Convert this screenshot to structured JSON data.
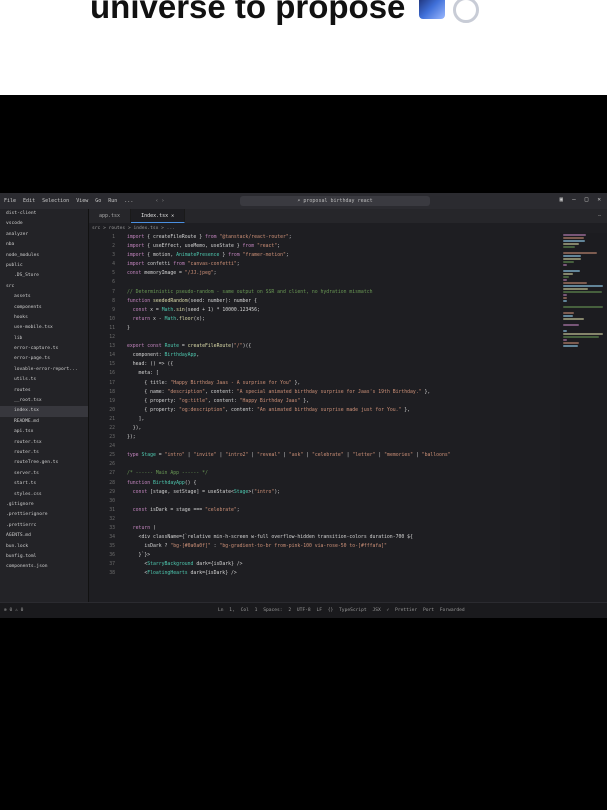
{
  "caption": {
    "text": "universe to propose",
    "emoji_1": "galaxy",
    "emoji_2": "ring"
  },
  "editor": {
    "menu": [
      "File",
      "Edit",
      "Selection",
      "View",
      "Go",
      "Run",
      "..."
    ],
    "search": "proposal birthday react",
    "tabs": [
      "app.tsx",
      "Index.tsx"
    ],
    "active_tab": 1,
    "breadcrumb": "src > routes > index.tsx > ...",
    "sidebar_items": [
      "dist-client",
      "vscode",
      "analyzer",
      "nba",
      "node_modules",
      "public",
      "  .DS_Store",
      "src",
      "  assets",
      "  components",
      "  hooks",
      "  use-mobile.tsx",
      "  lib",
      "  error-capture.ts",
      "  error-page.ts",
      "  lovable-error-report...",
      "  utils.ts",
      "  routes",
      "  __root.tsx",
      "  index.tsx",
      "  README.md",
      "  api.tsx",
      "  router.tsx",
      "  router.ts",
      "  routeTree.gen.ts",
      "  server.ts",
      "  start.ts",
      "  styles.css",
      ".gitignore",
      ".prettierignore",
      ".prettierrc",
      "AGENTS.md",
      "bun.lock",
      "bunfig.toml",
      "components.json"
    ],
    "code_lines": [
      "import { createFileRoute } from \"@tanstack/react-router\";",
      "import { useEffect, useMemo, useState } from \"react\";",
      "import { motion, AnimatePresence } from \"framer-motion\";",
      "import confetti from \"canvas-confetti\";",
      "const memoryImage = \"/JJ.jpeg\";",
      "",
      "// Deterministic pseudo-random - same output on SSR and client, no hydration mismatch",
      "function seededRandom(seed: number): number {",
      "  const x = Math.sin(seed + 1) * 10000.123456;",
      "  return x - Math.floor(x);",
      "}",
      "",
      "export const Route = createFileRoute(\"/\")({",
      "  component: BirthdayApp,",
      "  head: () => ({",
      "    meta: [",
      "      { title: \"Happy Birthday Jaas - A surprise for You\" },",
      "      { name: \"description\", content: \"A special animated birthday surprise for Jaas's 19th Birthday.\" },",
      "      { property: \"og:title\", content: \"Happy Birthday Jaas\" },",
      "      { property: \"og:description\", content: \"An animated birthday surprise made just for You.\" },",
      "    ],",
      "  }),",
      "});",
      "",
      "type Stage = \"intro\" | \"invite\" | \"intro2\" | \"reveal\" | \"ask\" | \"celebrate\" | \"letter\" | \"memories\" | \"balloons\"",
      "",
      "/* ------ Main App ------ */",
      "function BirthdayApp() {",
      "  const [stage, setStage] = useState<Stage>(\"intro\");",
      "",
      "  const isDark = stage === \"celebrate\";",
      "",
      "  return (",
      "    <div className={`relative min-h-screen w-full overflow-hidden transition-colors duration-700 ${",
      "      isDark ? \"bg-[#0a0a0f]\" : \"bg-gradient-to-br from-pink-100 via-rose-50 to-[#fffafa]\"",
      "    }`}>",
      "      <StarryBackground dark={isDark} />",
      "      <FloatingHearts dark={isDark} />"
    ],
    "status_left": "⊗ 0 ⚠ 0",
    "status_right": "Ln 1, Col 1   Spaces: 2   UTF-8   LF   {} TypeScript JSX   ✓ Prettier   Port Forwarded"
  },
  "colors": {
    "keyword": "#c586c0",
    "string": "#ce9178",
    "function": "#dcdcaa",
    "variable": "#9cdcfe",
    "comment": "#6a9955",
    "type": "#4ec9b0",
    "plain": "#d4d4d4"
  }
}
